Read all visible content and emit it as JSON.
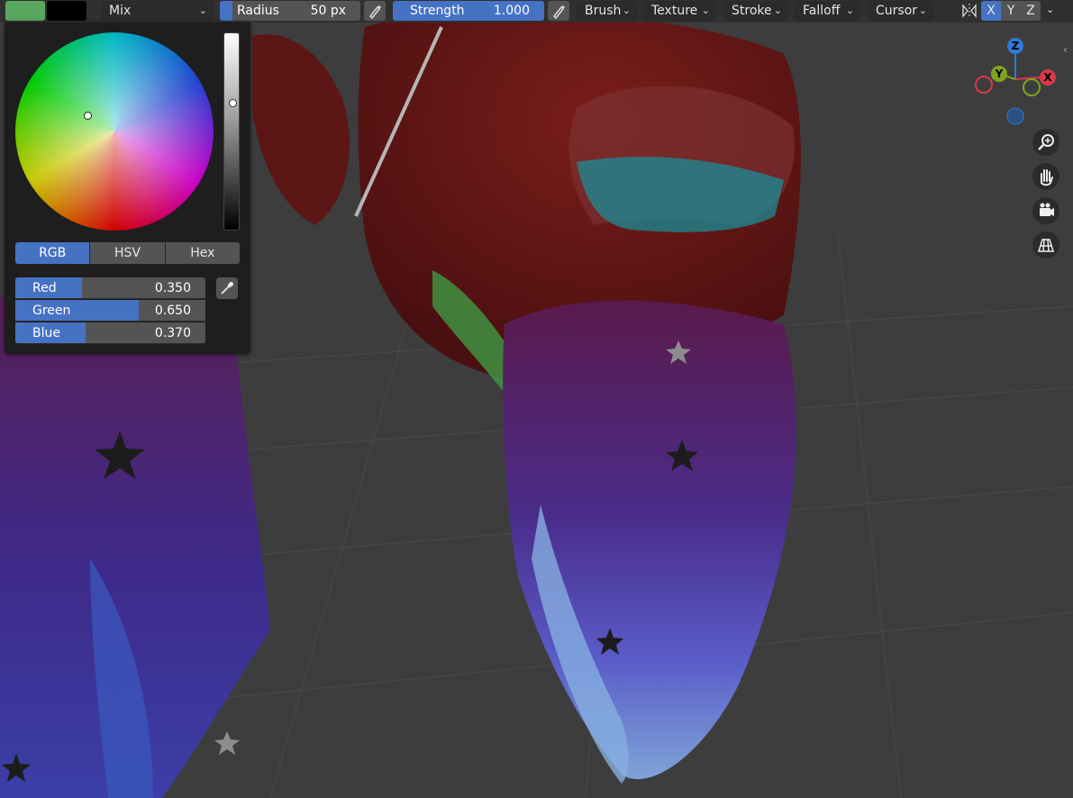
{
  "header": {
    "primary_color": "#59a65e",
    "secondary_color": "#000000",
    "blend_mode": "Mix",
    "radius": {
      "label": "Radius",
      "value": "50 px"
    },
    "strength": {
      "label": "Strength",
      "value": "1.000",
      "fraction": 1.0
    },
    "menus": [
      "Brush",
      "Texture",
      "Stroke",
      "Falloff",
      "Cursor"
    ],
    "mirror_axes": [
      "X",
      "Y",
      "Z"
    ]
  },
  "color_panel": {
    "tabs": [
      "RGB",
      "HSV",
      "Hex"
    ],
    "active_tab": "RGB",
    "channels": [
      {
        "label": "Red",
        "value": "0.350",
        "fraction": 0.35
      },
      {
        "label": "Green",
        "value": "0.650",
        "fraction": 0.65
      },
      {
        "label": "Blue",
        "value": "0.370",
        "fraction": 0.37
      }
    ]
  },
  "gizmo": {
    "z": "Z",
    "y": "Y",
    "x": "X"
  },
  "colors": {
    "accent": "#4672c4",
    "x_axis": "#d8394c",
    "y_axis": "#7ea31f",
    "z_axis": "#2f7ad4"
  },
  "icons": [
    "eyedropper-icon",
    "zoom-icon",
    "hand-pan-icon",
    "camera-icon",
    "grid-icon"
  ]
}
